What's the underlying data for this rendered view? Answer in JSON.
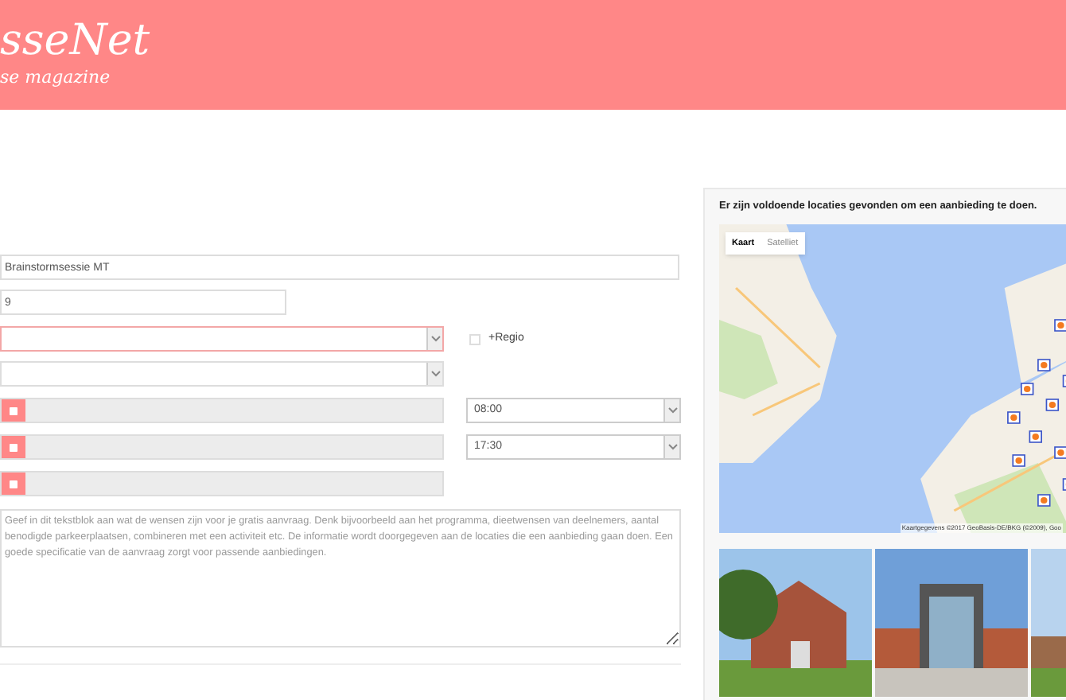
{
  "header": {
    "logo": "sseNet",
    "tagline": "se magazine"
  },
  "form": {
    "name_value": "Brainstormsessie MT",
    "count_value": "9",
    "regio": {
      "label": "+Regio",
      "checked": false
    },
    "dates": [
      {
        "kind": "datetime",
        "time": "08:00"
      },
      {
        "kind": "datetime",
        "time": "17:30"
      },
      {
        "kind": "date"
      }
    ],
    "remarks_placeholder": "Geef in dit tekstblok aan wat de wensen zijn voor je gratis aanvraag. Denk bijvoorbeeld aan het programma, dieetwensen van deelnemers, aantal benodigde parkeerplaatsen, combineren met een activiteit etc. De informatie wordt doorgegeven aan de locaties die een aanbieding gaan doen. Een goede specificatie van de aanvraag zorgt voor passende aanbiedingen."
  },
  "sidebar": {
    "message": "Er zijn voldoende locaties gevonden om een aanbieding te doen.",
    "map": {
      "tabs": [
        {
          "label": "Kaart",
          "selected": true
        },
        {
          "label": "Satelliet",
          "selected": false
        }
      ],
      "attribution": "Kaartgegevens ©2017 GeoBasis-DE/BKG (©2009), Goo"
    }
  }
}
